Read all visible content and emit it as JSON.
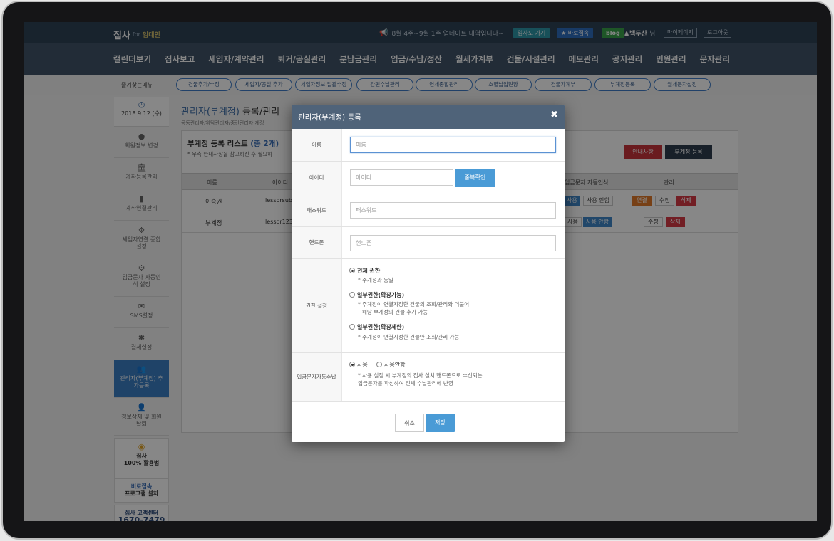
{
  "header": {
    "logo": "집사",
    "logo_for": "for",
    "logo_sub": "임대인",
    "notice": "8월 4주~9월 1주 업데이트 내역입니다~",
    "btn_jipsamo": "임사모 가기",
    "btn_remote": "★ 바로접속",
    "btn_blog": "blog",
    "user_name": "♟백두산",
    "user_suffix": "님",
    "btn_mypage": "마이페이지",
    "btn_logout": "로그아웃",
    "colors": {
      "top": "#2f4256",
      "nav": "#405368",
      "remote": "#2e6fbf",
      "blog": "#3aa24a",
      "jipsamo": "#2f97a8"
    }
  },
  "nav": [
    "캘린더보기",
    "집사보고",
    "세입자/계약관리",
    "퇴거/공실관리",
    "분납금관리",
    "입금/수납/정산",
    "월세가계부",
    "건물/시설관리",
    "메모관리",
    "공지관리",
    "민원관리",
    "문자관리"
  ],
  "shortcuts": {
    "label": "즐겨찾는메뉴",
    "items": [
      "건물추가/수정",
      "세입자/공실 추가",
      "세입자정보 일괄수정",
      "간편수납관리",
      "연체종합관리",
      "호별납입현황",
      "건물가계부",
      "부계정등록",
      "월세문자설정"
    ]
  },
  "sidebar": {
    "date": "2018.9.12 (수)",
    "items": [
      "회원정보 변경",
      "계좌등록관리",
      "계좌연결관리",
      "세입자연결 종합설정",
      "입금문자 자동인식 설정",
      "SMS설정",
      "결제설정",
      "관리자(부계정) 추가등록",
      "정보삭제 및 회원탈퇴"
    ],
    "promo_title": "집사",
    "promo_sub": "100% 활용법",
    "remote_title": "비로접속",
    "remote_sub": "프로그램 설치",
    "cs_title": "집사 고객센터",
    "cs_phone": "1670-7479"
  },
  "page": {
    "title": "관리자(부계정)",
    "title_suffix": "등록/관리",
    "breadcrumb": "공동관리자/위탁관리자/중간관리자 계정",
    "list_title": "부계정 등록 리스트",
    "list_count": "(총 2개)",
    "list_note": "* 우측 안내사항을 참고하신 후 필요하",
    "btn_info": "안내사항",
    "btn_register": "부계정 등록",
    "columns": [
      "이름",
      "아이디",
      "입금문자 자동인식",
      "관리"
    ],
    "rows": [
      {
        "name": "이승권",
        "id": "lessorsub",
        "auto_on": "사용",
        "auto_off": "사용 안함",
        "actions": [
          "연결",
          "수정",
          "삭제"
        ]
      },
      {
        "name": "부계정",
        "id": "lessor123",
        "auto_on": "사용",
        "auto_off": "사용 안함",
        "actions": [
          "수정",
          "삭제"
        ]
      }
    ]
  },
  "modal": {
    "title": "관리자(부계정) 등록",
    "close": "✖",
    "name_label": "이름",
    "name_placeholder": "이름",
    "id_label": "아이디",
    "id_placeholder": "아이디",
    "check_btn": "중복확인",
    "pw_label": "패스워드",
    "pw_placeholder": "패스워드",
    "phone_label": "핸드폰",
    "phone_placeholder": "핸드폰",
    "perm_label": "권한 설정",
    "perm_full": "전체 권한",
    "perm_full_note": "* 주계정과 동일",
    "perm_partial_ext": "일부권한(확장가능)",
    "perm_partial_ext_note1": "* 주계정이 연결지정한 건물의 조회/관리와 더불어",
    "perm_partial_ext_note2": "해당 부계정의 건물 추가 가능",
    "perm_partial_lim": "일부권한(확장제한)",
    "perm_partial_lim_note": "* 주계정이 연결지정한 건물만 조회/관리 가능",
    "sms_label1": "입금문자",
    "sms_label2": "자동수납",
    "sms_on": "사용",
    "sms_off": "사용안함",
    "sms_note1": "* 사용 설정 시 부계정의 집사 설치 핸드폰으로 수신되는",
    "sms_note2": "입금문자를 파싱하여 전체 수납관리에 반영",
    "cancel": "취소",
    "save": "저장"
  }
}
